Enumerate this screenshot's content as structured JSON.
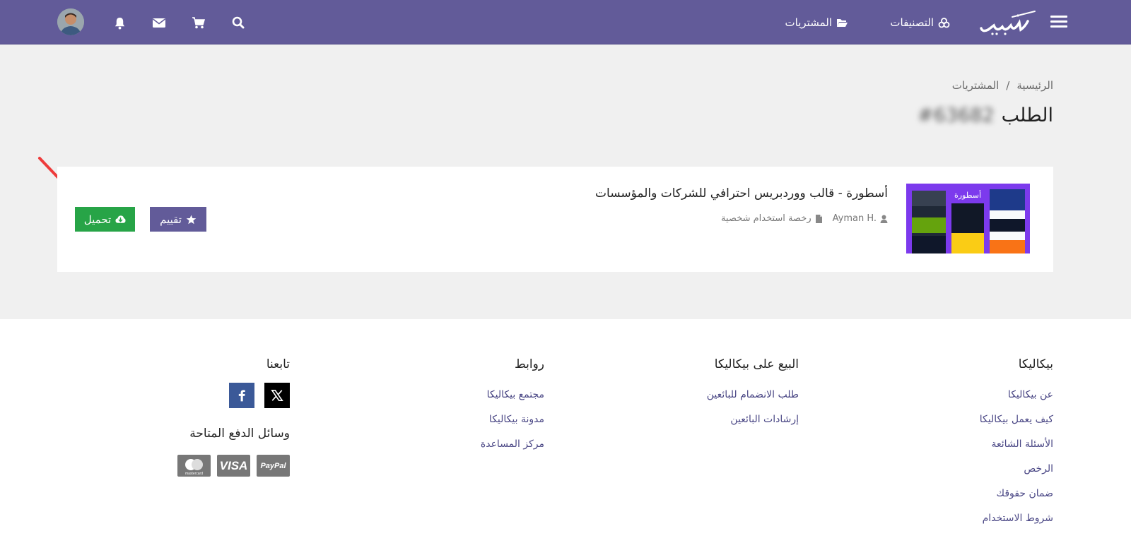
{
  "colors": {
    "brand": "#625b99",
    "download": "#27a447",
    "link": "#4a4785"
  },
  "nav": {
    "logo_text": "بيكاليكا",
    "categories_label": "التصنيفات",
    "purchases_label": "المشتريات",
    "icons": [
      "menu-icon",
      "search-icon",
      "cart-icon",
      "mail-icon",
      "bell-icon",
      "avatar"
    ]
  },
  "breadcrumb": {
    "home": "الرئيسية",
    "separator": "/",
    "current": "المشتريات"
  },
  "page": {
    "title_word": "الطلب",
    "order_number": "#63682"
  },
  "order_item": {
    "title": "أسطورة - قالب ووردبريس احترافي للشركات والمؤسسات",
    "thumbnail_text": "أسطورة",
    "seller": "Ayman H.",
    "license": "رخصة استخدام شخصية",
    "rate_label": "تقييم",
    "download_label": "تحميل"
  },
  "footer": {
    "col1": {
      "title": "بيكاليكا",
      "links": [
        "عن بيكاليكا",
        "كيف يعمل بيكاليكا",
        "الأسئلة الشائعة",
        "الرخص",
        "ضمان حقوقك",
        "شروط الاستخدام"
      ]
    },
    "col2": {
      "title": "البيع على بيكاليكا",
      "links": [
        "طلب الانضمام للبائعين",
        "إرشادات البائعين"
      ]
    },
    "col3": {
      "title": "روابط",
      "links": [
        "مجتمع بيكاليكا",
        "مدونة بيكاليكا",
        "مركز المساعدة"
      ]
    },
    "col4": {
      "title": "تابعنا",
      "payments_title": "وسائل الدفع المتاحة",
      "payment_cards": {
        "paypal": "PayPal",
        "visa": "VISA",
        "mastercard": "mastercard"
      }
    }
  }
}
